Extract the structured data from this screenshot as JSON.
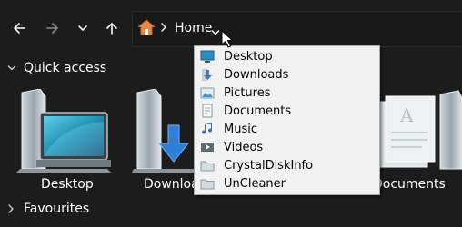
{
  "toolbar": {
    "back_icon": "arrow-left-icon",
    "forward_icon": "arrow-right-icon",
    "recent_icon": "chevron-down-icon",
    "up_icon": "arrow-up-icon"
  },
  "address_bar": {
    "location_icon": "home-icon",
    "location": "Home",
    "separator": "›"
  },
  "quick_access": {
    "label": "Quick access",
    "items": [
      {
        "label": "Desktop"
      },
      {
        "label": "Downloads"
      },
      {
        "label": "Documents"
      }
    ]
  },
  "favourites": {
    "label": "Favourites"
  },
  "dropdown": {
    "items": [
      {
        "label": "Desktop",
        "icon": "desktop-icon"
      },
      {
        "label": "Downloads",
        "icon": "downloads-icon"
      },
      {
        "label": "Pictures",
        "icon": "pictures-icon"
      },
      {
        "label": "Documents",
        "icon": "documents-icon"
      },
      {
        "label": "Music",
        "icon": "music-icon"
      },
      {
        "label": "Videos",
        "icon": "videos-icon"
      },
      {
        "label": "CrystalDiskInfo",
        "icon": "folder-shortcut-icon"
      },
      {
        "label": "UnCleaner",
        "icon": "folder-shortcut-icon"
      }
    ]
  },
  "colors": {
    "background": "#1c1c1c",
    "menu_background": "#f2f2f2",
    "home_accent": "#e8894a"
  }
}
